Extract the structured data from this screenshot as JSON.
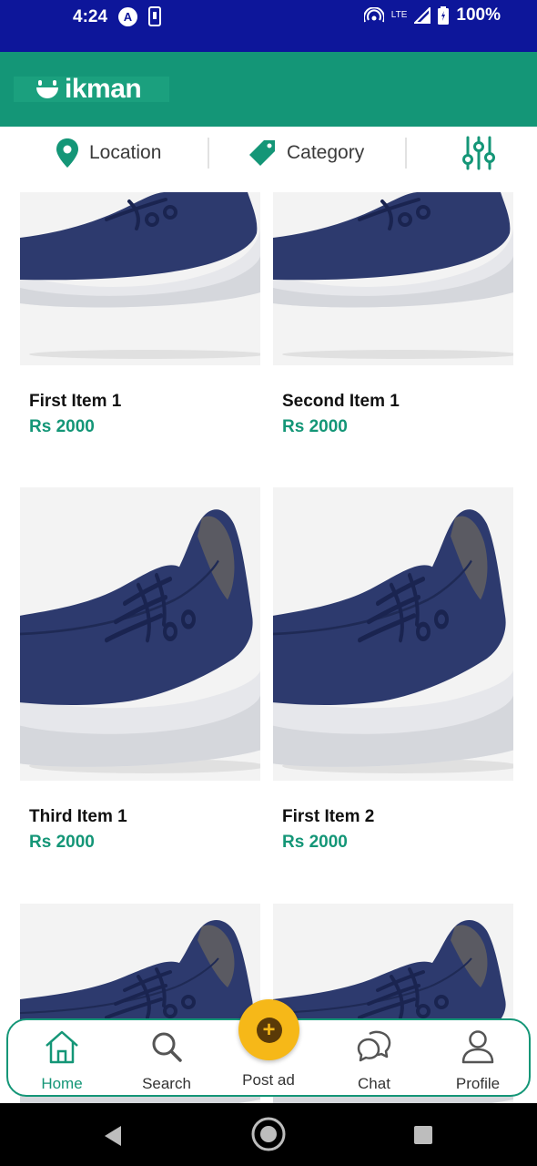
{
  "status_bar": {
    "time": "4:24",
    "battery": "100%",
    "network": "LTE"
  },
  "header": {
    "logo_text": "ikman"
  },
  "filters": {
    "location_label": "Location",
    "category_label": "Category"
  },
  "items": [
    {
      "title": "First Item 1",
      "price": "Rs 2000"
    },
    {
      "title": "Second Item 1",
      "price": "Rs 2000"
    },
    {
      "title": "Third Item 1",
      "price": "Rs 2000"
    },
    {
      "title": "First Item 2",
      "price": "Rs 2000"
    },
    {
      "title": "",
      "price": ""
    },
    {
      "title": "",
      "price": ""
    }
  ],
  "bottom_nav": {
    "home": "Home",
    "search": "Search",
    "post_ad": "Post ad",
    "chat": "Chat",
    "profile": "Profile"
  },
  "colors": {
    "brand": "#149677",
    "status_bar": "#0d169a",
    "fab": "#f6b818"
  }
}
